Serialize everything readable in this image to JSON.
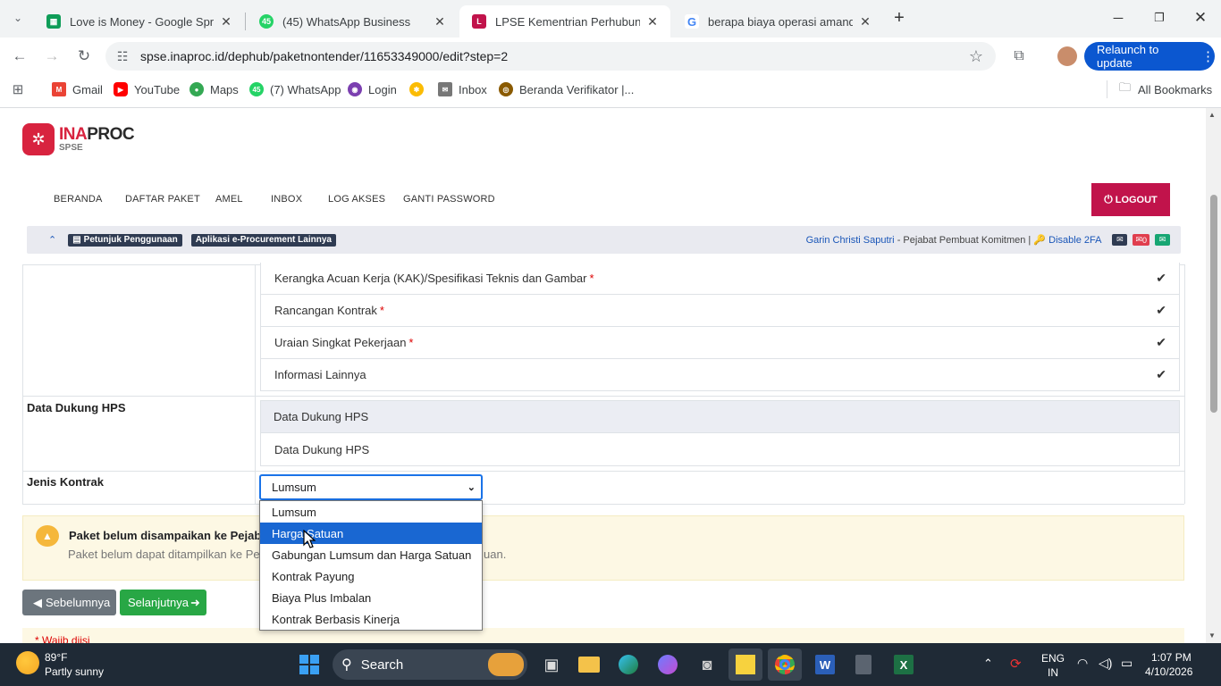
{
  "browser": {
    "tabs": [
      {
        "title": "Love is Money - Google Spreads",
        "favicon": "sheets-icon",
        "color": "#0f9d58"
      },
      {
        "title": "(45) WhatsApp Business",
        "favicon": "whatsapp-icon",
        "color": "#25d366",
        "badge": "45"
      },
      {
        "title": "LPSE Kementrian Perhubungan",
        "favicon": "lpse-icon",
        "color": "#c1134b"
      },
      {
        "title": "berapa biaya operasi amandel",
        "favicon": "google-icon",
        "color": "#4285f4"
      }
    ],
    "url": "spse.inaproc.id/dephub/paketnontender/11653349000/edit?step=2",
    "relaunch": "Relaunch to update",
    "bookmarks": [
      {
        "label": "Gmail",
        "color": "#ea4335"
      },
      {
        "label": "YouTube",
        "color": "#ff0000"
      },
      {
        "label": "Maps",
        "color": "#34a853"
      },
      {
        "label": "(7) WhatsApp",
        "color": "#25d366",
        "badge": "45"
      },
      {
        "label": "Login",
        "color": "#7b3fb0"
      },
      {
        "label": "",
        "color": "#fbbc04"
      },
      {
        "label": "Inbox",
        "color": "#777"
      },
      {
        "label": "Beranda Verifikator |...",
        "color": "#8a5a00"
      }
    ],
    "all_bookmarks": "All Bookmarks"
  },
  "site": {
    "logo_main": "INAPROC",
    "logo_sub": "SPSE",
    "nav": [
      "BERANDA",
      "DAFTAR PAKET",
      "AMEL",
      "INBOX",
      "LOG AKSES",
      "GANTI PASSWORD"
    ],
    "logout": "LOGOUT",
    "petunjuk": "Petunjuk Penggunaan",
    "aplikasi": "Aplikasi e-Procurement Lainnya",
    "user_name": "Garin Christi Saputri",
    "user_role": " - Pejabat Pembuat Komitmen | ",
    "disable_2fa": "Disable 2FA",
    "mail_count": "0"
  },
  "form": {
    "documents": [
      {
        "label": "Kerangka Acuan Kerja (KAK)/Spesifikasi Teknis dan Gambar",
        "required": "*"
      },
      {
        "label": "Rancangan Kontrak",
        "required": "*"
      },
      {
        "label": "Uraian Singkat Pekerjaan",
        "required": "*"
      },
      {
        "label": "Informasi Lainnya",
        "required": ""
      }
    ],
    "hps_label": "Data Dukung HPS",
    "hps_header": "Data Dukung HPS",
    "hps_item": "Data Dukung HPS",
    "jenis_label": "Jenis Kontrak",
    "jenis_value": "Lumsum",
    "options": [
      "Lumsum",
      "Harga Satuan",
      "Gabungan Lumsum dan Harga Satuan",
      "Kontrak Payung",
      "Biaya Plus Imbalan",
      "Kontrak Berbasis Kinerja"
    ],
    "selected_option": "Harga Satuan",
    "alert_title": "Paket belum disampaikan ke Pejabat",
    "alert_body_start": "Paket belum dapat ditampilkan ke Pejaba",
    "alert_body_end": "uan.",
    "prev_button": "Sebelumnya",
    "next_button": "Selanjutnya",
    "footnote": "* Wajib diisi"
  },
  "taskbar": {
    "weather_temp": "89°F",
    "weather_desc": "Partly sunny",
    "search": "Search",
    "lang": "ENG",
    "region": "IN",
    "time": "1:07 PM",
    "date": "4/10/2026"
  }
}
